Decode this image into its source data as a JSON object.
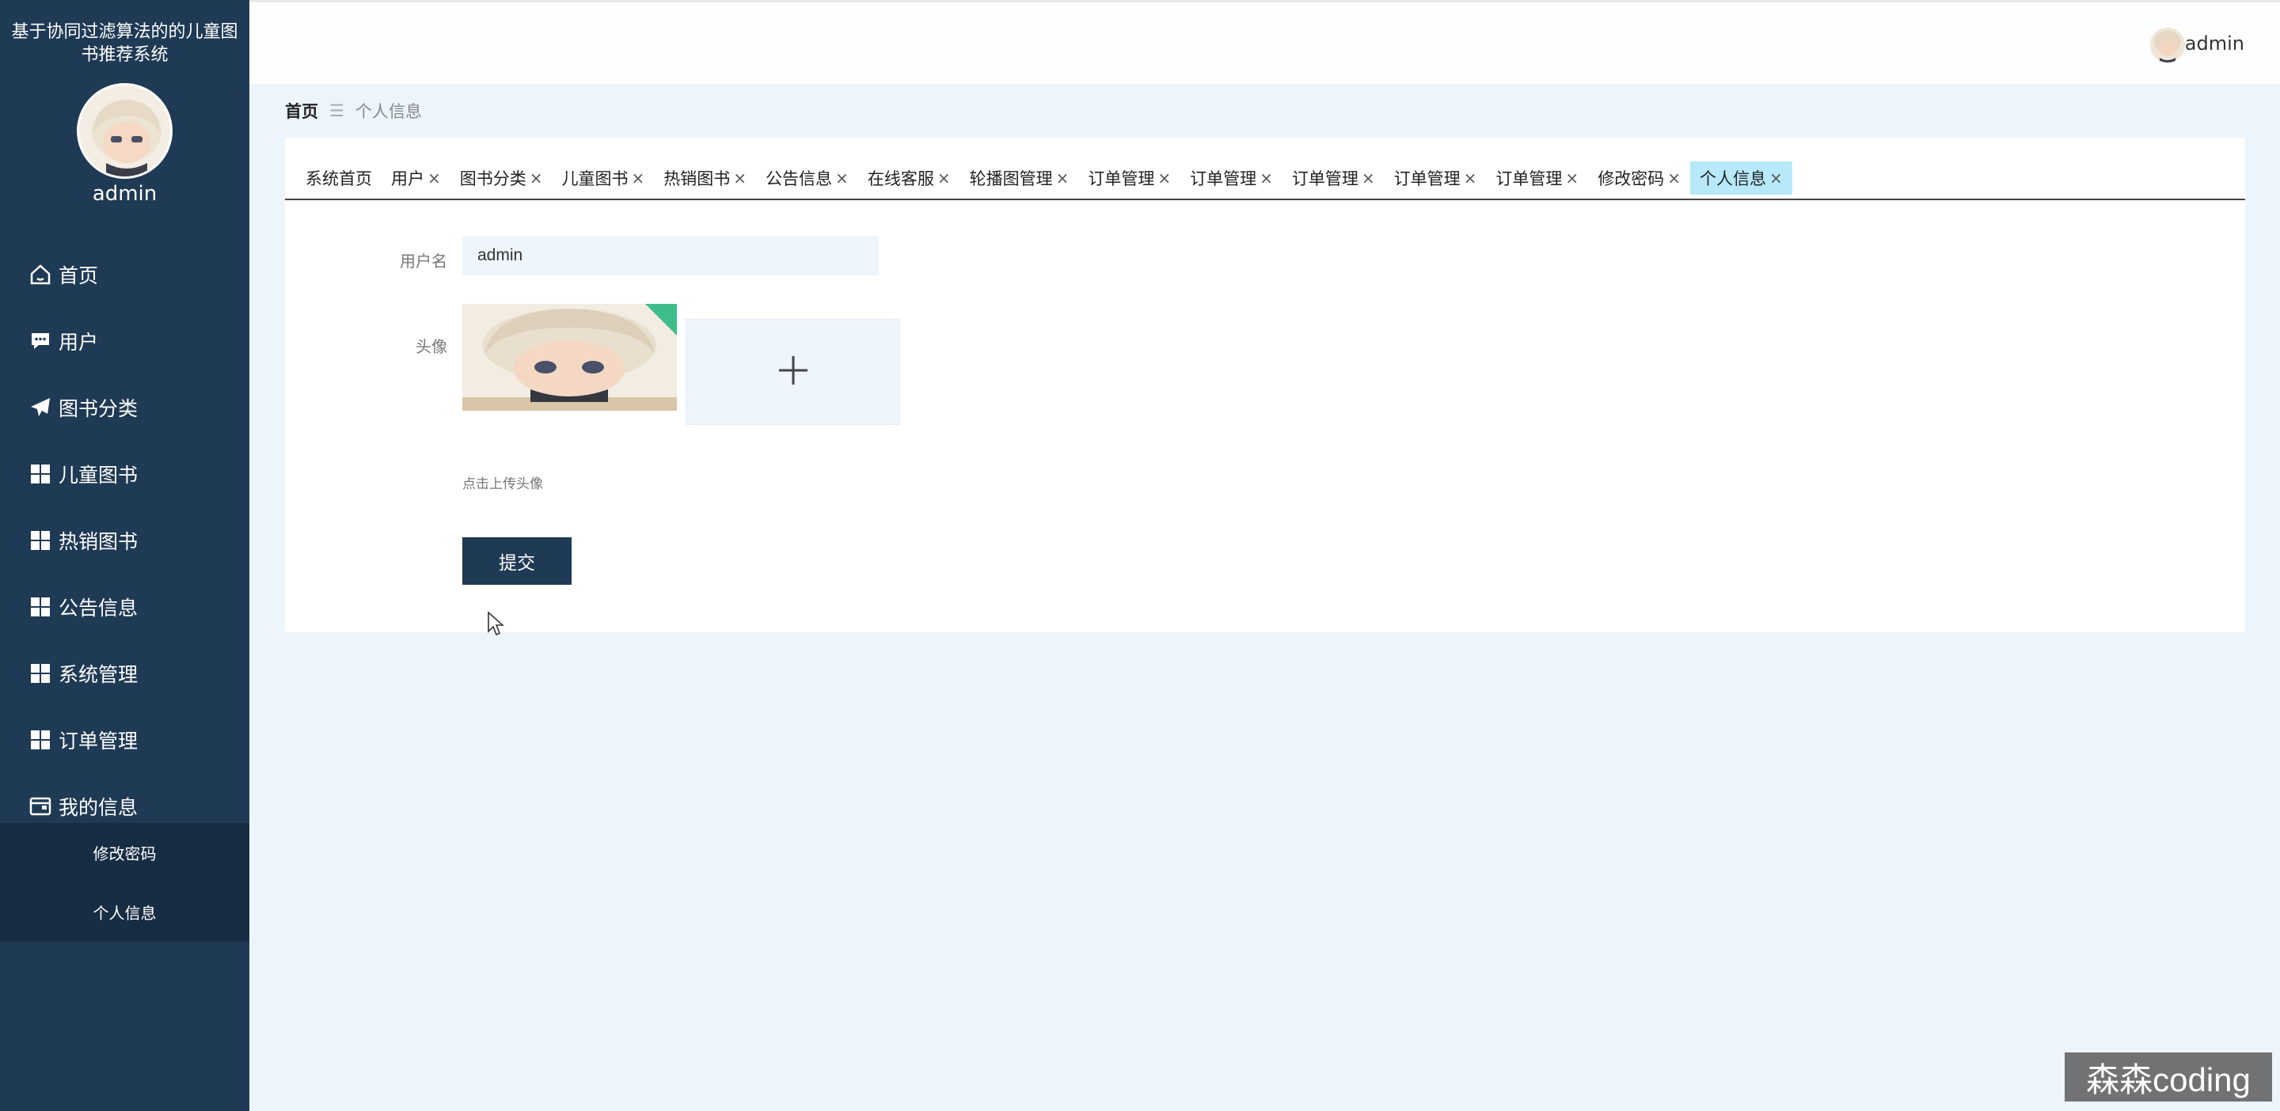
{
  "app": {
    "title": "基于协同过滤算法的的儿童图书推荐系统"
  },
  "sidebar": {
    "username": "admin",
    "menu": [
      {
        "label": "首页",
        "icon": "home-icon"
      },
      {
        "label": "用户",
        "icon": "chat-icon"
      },
      {
        "label": "图书分类",
        "icon": "paper-plane-icon"
      },
      {
        "label": "儿童图书",
        "icon": "grid-icon"
      },
      {
        "label": "热销图书",
        "icon": "grid-icon"
      },
      {
        "label": "公告信息",
        "icon": "grid-icon"
      },
      {
        "label": "系统管理",
        "icon": "grid-icon"
      },
      {
        "label": "订单管理",
        "icon": "grid-icon"
      },
      {
        "label": "我的信息",
        "icon": "wallet-icon"
      }
    ],
    "submenu": [
      {
        "label": "修改密码"
      },
      {
        "label": "个人信息"
      }
    ]
  },
  "header": {
    "username": "admin"
  },
  "breadcrumb": {
    "home": "首页",
    "separator": "☰",
    "current": "个人信息"
  },
  "tabs": [
    {
      "label": "系统首页",
      "closable": false
    },
    {
      "label": "用户",
      "closable": true
    },
    {
      "label": "图书分类",
      "closable": true
    },
    {
      "label": "儿童图书",
      "closable": true
    },
    {
      "label": "热销图书",
      "closable": true
    },
    {
      "label": "公告信息",
      "closable": true
    },
    {
      "label": "在线客服",
      "closable": true
    },
    {
      "label": "轮播图管理",
      "closable": true
    },
    {
      "label": "订单管理",
      "closable": true
    },
    {
      "label": "订单管理",
      "closable": true
    },
    {
      "label": "订单管理",
      "closable": true
    },
    {
      "label": "订单管理",
      "closable": true
    },
    {
      "label": "订单管理",
      "closable": true
    },
    {
      "label": "修改密码",
      "closable": true
    },
    {
      "label": "个人信息",
      "closable": true,
      "active": true
    }
  ],
  "tab_close_glyph": "×",
  "form": {
    "username_label": "用户名",
    "username_value": "admin",
    "avatar_label": "头像",
    "upload_plus": "+",
    "upload_hint": "点击上传头像",
    "submit_label": "提交"
  },
  "watermark": "森森coding",
  "colors": {
    "sidebar_bg": "#1f3a54",
    "submenu_bg": "#172d44",
    "page_bg": "#ecf4fc",
    "active_tab": "#b7e9fb",
    "upload_corner": "#3dbd8a"
  }
}
